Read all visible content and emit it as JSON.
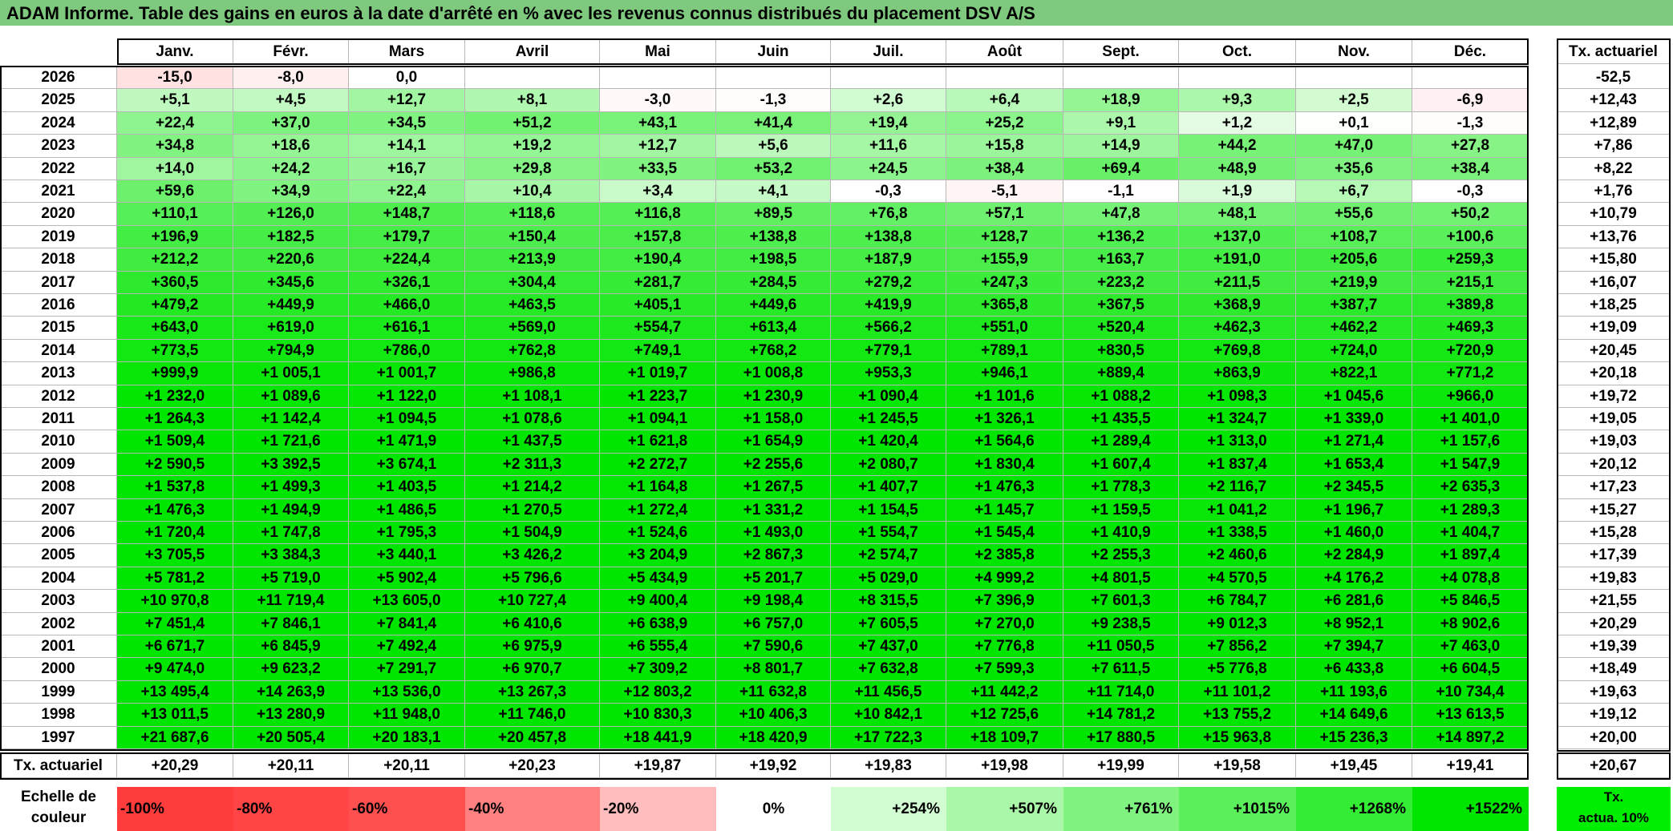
{
  "title": "ADAM Informe. Table des gains en euros à la date d'arrêté en % avec les revenus connus distribués du placement DSV A/S",
  "months": [
    "Janv.",
    "Févr.",
    "Mars",
    "Avril",
    "Mai",
    "Juin",
    "Juil.",
    "Août",
    "Sept.",
    "Oct.",
    "Nov.",
    "Déc."
  ],
  "tx_header": "Tx. actuariel",
  "rows": [
    {
      "year": "2026",
      "values": [
        "-15,0",
        "-8,0",
        "0,0",
        "",
        "",
        "",
        "",
        "",
        "",
        "",
        "",
        ""
      ],
      "tx": "-52,5"
    },
    {
      "year": "2025",
      "values": [
        "+5,1",
        "+4,5",
        "+12,7",
        "+8,1",
        "-3,0",
        "-1,3",
        "+2,6",
        "+6,4",
        "+18,9",
        "+9,3",
        "+2,5",
        "-6,9"
      ],
      "tx": "+12,43"
    },
    {
      "year": "2024",
      "values": [
        "+22,4",
        "+37,0",
        "+34,5",
        "+51,2",
        "+43,1",
        "+41,4",
        "+19,4",
        "+25,2",
        "+9,1",
        "+1,2",
        "+0,1",
        "-1,3"
      ],
      "tx": "+12,89"
    },
    {
      "year": "2023",
      "values": [
        "+34,8",
        "+18,6",
        "+14,1",
        "+19,2",
        "+12,7",
        "+5,6",
        "+11,6",
        "+15,8",
        "+14,9",
        "+44,2",
        "+47,0",
        "+27,8"
      ],
      "tx": "+7,86"
    },
    {
      "year": "2022",
      "values": [
        "+14,0",
        "+24,2",
        "+16,7",
        "+29,8",
        "+33,5",
        "+53,2",
        "+24,5",
        "+38,4",
        "+69,4",
        "+48,9",
        "+35,6",
        "+38,4"
      ],
      "tx": "+8,22"
    },
    {
      "year": "2021",
      "values": [
        "+59,6",
        "+34,9",
        "+22,4",
        "+10,4",
        "+3,4",
        "+4,1",
        "-0,3",
        "-5,1",
        "-1,1",
        "+1,9",
        "+6,7",
        "-0,3"
      ],
      "tx": "+1,76"
    },
    {
      "year": "2020",
      "values": [
        "+110,1",
        "+126,0",
        "+148,7",
        "+118,6",
        "+116,8",
        "+89,5",
        "+76,8",
        "+57,1",
        "+47,8",
        "+48,1",
        "+55,6",
        "+50,2"
      ],
      "tx": "+10,79"
    },
    {
      "year": "2019",
      "values": [
        "+196,9",
        "+182,5",
        "+179,7",
        "+150,4",
        "+157,8",
        "+138,8",
        "+138,8",
        "+128,7",
        "+136,2",
        "+137,0",
        "+108,7",
        "+100,6"
      ],
      "tx": "+13,76"
    },
    {
      "year": "2018",
      "values": [
        "+212,2",
        "+220,6",
        "+224,4",
        "+213,9",
        "+190,4",
        "+198,5",
        "+187,9",
        "+155,9",
        "+163,7",
        "+191,0",
        "+205,6",
        "+259,3"
      ],
      "tx": "+15,80"
    },
    {
      "year": "2017",
      "values": [
        "+360,5",
        "+345,6",
        "+326,1",
        "+304,4",
        "+281,7",
        "+284,5",
        "+279,2",
        "+247,3",
        "+223,2",
        "+211,5",
        "+219,9",
        "+215,1"
      ],
      "tx": "+16,07"
    },
    {
      "year": "2016",
      "values": [
        "+479,2",
        "+449,9",
        "+466,0",
        "+463,5",
        "+405,1",
        "+449,6",
        "+419,9",
        "+365,8",
        "+367,5",
        "+368,9",
        "+387,7",
        "+389,8"
      ],
      "tx": "+18,25"
    },
    {
      "year": "2015",
      "values": [
        "+643,0",
        "+619,0",
        "+616,1",
        "+569,0",
        "+554,7",
        "+613,4",
        "+566,2",
        "+551,0",
        "+520,4",
        "+462,3",
        "+462,2",
        "+469,3"
      ],
      "tx": "+19,09"
    },
    {
      "year": "2014",
      "values": [
        "+773,5",
        "+794,9",
        "+786,0",
        "+762,8",
        "+749,1",
        "+768,2",
        "+779,1",
        "+789,1",
        "+830,5",
        "+769,8",
        "+724,0",
        "+720,9"
      ],
      "tx": "+20,45"
    },
    {
      "year": "2013",
      "values": [
        "+999,9",
        "+1 005,1",
        "+1 001,7",
        "+986,8",
        "+1 019,7",
        "+1 008,8",
        "+953,3",
        "+946,1",
        "+889,4",
        "+863,9",
        "+822,1",
        "+771,2"
      ],
      "tx": "+20,18"
    },
    {
      "year": "2012",
      "values": [
        "+1 232,0",
        "+1 089,6",
        "+1 122,0",
        "+1 108,1",
        "+1 223,7",
        "+1 230,9",
        "+1 090,4",
        "+1 101,6",
        "+1 088,2",
        "+1 098,3",
        "+1 045,6",
        "+966,0"
      ],
      "tx": "+19,72"
    },
    {
      "year": "2011",
      "values": [
        "+1 264,3",
        "+1 142,4",
        "+1 094,5",
        "+1 078,6",
        "+1 094,1",
        "+1 158,0",
        "+1 245,5",
        "+1 326,1",
        "+1 435,5",
        "+1 324,7",
        "+1 339,0",
        "+1 401,0"
      ],
      "tx": "+19,05"
    },
    {
      "year": "2010",
      "values": [
        "+1 509,4",
        "+1 721,6",
        "+1 471,9",
        "+1 437,5",
        "+1 621,8",
        "+1 654,9",
        "+1 420,4",
        "+1 564,6",
        "+1 289,4",
        "+1 313,0",
        "+1 271,4",
        "+1 157,6"
      ],
      "tx": "+19,03"
    },
    {
      "year": "2009",
      "values": [
        "+2 590,5",
        "+3 392,5",
        "+3 674,1",
        "+2 311,3",
        "+2 272,7",
        "+2 255,6",
        "+2 080,7",
        "+1 830,4",
        "+1 607,4",
        "+1 837,4",
        "+1 653,4",
        "+1 547,9"
      ],
      "tx": "+20,12"
    },
    {
      "year": "2008",
      "values": [
        "+1 537,8",
        "+1 499,3",
        "+1 403,5",
        "+1 214,2",
        "+1 164,8",
        "+1 267,5",
        "+1 407,7",
        "+1 476,3",
        "+1 778,3",
        "+2 116,7",
        "+2 345,5",
        "+2 635,3"
      ],
      "tx": "+17,23"
    },
    {
      "year": "2007",
      "values": [
        "+1 476,3",
        "+1 494,9",
        "+1 486,5",
        "+1 270,5",
        "+1 272,4",
        "+1 331,2",
        "+1 154,5",
        "+1 145,7",
        "+1 159,5",
        "+1 041,2",
        "+1 196,7",
        "+1 289,3"
      ],
      "tx": "+15,27"
    },
    {
      "year": "2006",
      "values": [
        "+1 720,4",
        "+1 747,8",
        "+1 795,3",
        "+1 504,9",
        "+1 524,6",
        "+1 493,0",
        "+1 554,7",
        "+1 545,4",
        "+1 410,9",
        "+1 338,5",
        "+1 460,0",
        "+1 404,7"
      ],
      "tx": "+15,28"
    },
    {
      "year": "2005",
      "values": [
        "+3 705,5",
        "+3 384,3",
        "+3 440,1",
        "+3 426,2",
        "+3 204,9",
        "+2 867,3",
        "+2 574,7",
        "+2 385,8",
        "+2 255,3",
        "+2 460,6",
        "+2 284,9",
        "+1 897,4"
      ],
      "tx": "+17,39"
    },
    {
      "year": "2004",
      "values": [
        "+5 781,2",
        "+5 719,0",
        "+5 902,4",
        "+5 796,6",
        "+5 434,9",
        "+5 201,7",
        "+5 029,0",
        "+4 999,2",
        "+4 801,5",
        "+4 570,5",
        "+4 176,2",
        "+4 078,8"
      ],
      "tx": "+19,83"
    },
    {
      "year": "2003",
      "values": [
        "+10 970,8",
        "+11 719,4",
        "+13 605,0",
        "+10 727,4",
        "+9 400,4",
        "+9 198,4",
        "+8 315,5",
        "+7 396,9",
        "+7 601,3",
        "+6 784,7",
        "+6 281,6",
        "+5 846,5"
      ],
      "tx": "+21,55"
    },
    {
      "year": "2002",
      "values": [
        "+7 451,4",
        "+7 846,1",
        "+7 841,4",
        "+6 410,6",
        "+6 638,9",
        "+6 757,0",
        "+7 605,5",
        "+7 270,0",
        "+9 238,5",
        "+9 012,3",
        "+8 952,1",
        "+8 902,6"
      ],
      "tx": "+20,29"
    },
    {
      "year": "2001",
      "values": [
        "+6 671,7",
        "+6 845,9",
        "+7 492,4",
        "+6 975,9",
        "+6 555,4",
        "+7 590,6",
        "+7 437,0",
        "+7 776,8",
        "+11 050,5",
        "+7 856,2",
        "+7 394,7",
        "+7 463,0"
      ],
      "tx": "+19,39"
    },
    {
      "year": "2000",
      "values": [
        "+9 474,0",
        "+9 623,2",
        "+7 291,7",
        "+6 970,7",
        "+7 309,2",
        "+8 801,7",
        "+7 632,8",
        "+7 599,3",
        "+7 611,5",
        "+5 776,8",
        "+6 433,8",
        "+6 604,5"
      ],
      "tx": "+18,49"
    },
    {
      "year": "1999",
      "values": [
        "+13 495,4",
        "+14 263,9",
        "+13 536,0",
        "+13 267,3",
        "+12 803,2",
        "+11 632,8",
        "+11 456,5",
        "+11 442,2",
        "+11 714,0",
        "+11 101,2",
        "+11 193,6",
        "+10 734,4"
      ],
      "tx": "+19,63"
    },
    {
      "year": "1998",
      "values": [
        "+13 011,5",
        "+13 280,9",
        "+11 948,0",
        "+11 746,0",
        "+10 830,3",
        "+10 406,3",
        "+10 842,1",
        "+12 725,6",
        "+14 781,2",
        "+13 755,2",
        "+14 649,6",
        "+13 613,5"
      ],
      "tx": "+19,12"
    },
    {
      "year": "1997",
      "values": [
        "+21 687,6",
        "+20 505,4",
        "+20 183,1",
        "+20 457,8",
        "+18 441,9",
        "+18 420,9",
        "+17 722,3",
        "+18 109,7",
        "+17 880,5",
        "+15 963,8",
        "+15 236,3",
        "+14 897,2"
      ],
      "tx": "+20,00"
    }
  ],
  "footer": {
    "label": "Tx. actuariel",
    "values": [
      "+20,29",
      "+20,11",
      "+20,11",
      "+20,23",
      "+19,87",
      "+19,92",
      "+19,83",
      "+19,98",
      "+19,99",
      "+19,58",
      "+19,45",
      "+19,41"
    ],
    "total": "+20,67"
  },
  "scale": {
    "title_line1": "Echelle de",
    "title_line2": "couleur",
    "items": [
      {
        "label": "-100%",
        "color": "#ff3c3c"
      },
      {
        "label": "-80%",
        "color": "#ff4545"
      },
      {
        "label": "-60%",
        "color": "#ff5050"
      },
      {
        "label": "-40%",
        "color": "#ff8080"
      },
      {
        "label": "-20%",
        "color": "#ffbdbd"
      },
      {
        "label": "0%",
        "color": "#ffffff"
      },
      {
        "label": "+254%",
        "color": "#d2fdd2"
      },
      {
        "label": "+507%",
        "color": "#aaf7aa"
      },
      {
        "label": "+761%",
        "color": "#80f280"
      },
      {
        "label": "+1015%",
        "color": "#5bef5b"
      },
      {
        "label": "+1268%",
        "color": "#34ec34"
      },
      {
        "label": "+1522%",
        "color": "#00e600"
      }
    ],
    "tx_line1": "Tx.",
    "tx_line2": "actua. 10%"
  },
  "colors": {
    "title_bg": "#7fc97f",
    "tx_legend": "#00ee00"
  }
}
